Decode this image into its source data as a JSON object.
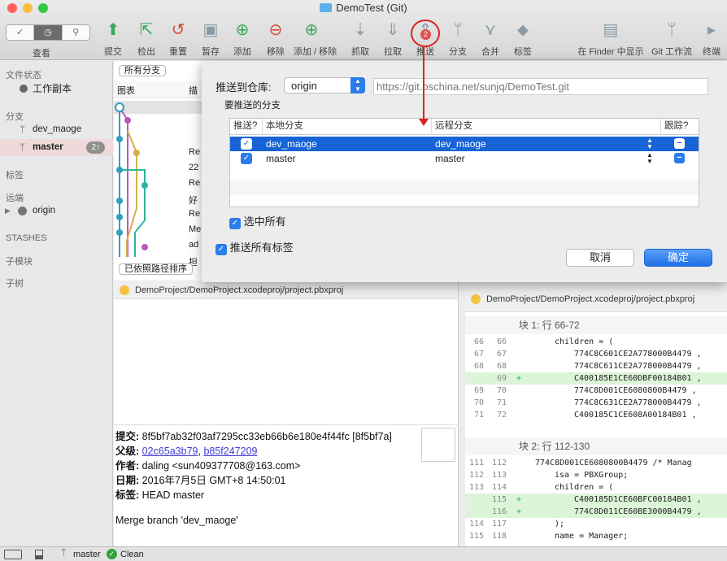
{
  "window": {
    "title": "DemoTest (Git)"
  },
  "toolbar": {
    "view_label": "查看",
    "items": [
      {
        "label": "提交",
        "icon": "commit-icon"
      },
      {
        "label": "检出",
        "icon": "checkout-icon"
      },
      {
        "label": "重置",
        "icon": "reset-icon"
      },
      {
        "label": "暂存",
        "icon": "stash-icon"
      },
      {
        "label": "添加",
        "icon": "add-icon"
      },
      {
        "label": "移除",
        "icon": "remove-icon"
      },
      {
        "label": "添加 / 移除",
        "icon": "add-remove-icon"
      },
      {
        "label": "抓取",
        "icon": "fetch-icon"
      },
      {
        "label": "拉取",
        "icon": "pull-icon"
      },
      {
        "label": "推送",
        "icon": "push-icon",
        "badge": "2"
      },
      {
        "label": "分支",
        "icon": "branch-icon"
      },
      {
        "label": "合并",
        "icon": "merge-icon"
      },
      {
        "label": "标签",
        "icon": "tag-icon"
      }
    ],
    "right_items": [
      {
        "label": "在 Finder 中显示",
        "icon": "finder-icon"
      },
      {
        "label": "Git 工作流",
        "icon": "git-flow-icon"
      },
      {
        "label": "终端",
        "icon": "terminal-icon"
      }
    ]
  },
  "sidebar": {
    "file_status": "文件状态",
    "working_copy": "工作副本",
    "branches": "分支",
    "branch_items": [
      {
        "name": "dev_maoge"
      },
      {
        "name": "master",
        "badge": "2↑"
      }
    ],
    "tags": "标签",
    "remotes": "远端",
    "remote_items": [
      {
        "name": "origin"
      }
    ],
    "stashes": "STASHES",
    "submodules": "子模块",
    "subtrees": "子树"
  },
  "graph": {
    "filter": "所有分支",
    "col_graph": "图表",
    "col_desc": "描",
    "sort": "已依照路径排序",
    "row_snippets": [
      "Re",
      "22",
      "Re",
      "好",
      "Re",
      "Me",
      "ad",
      "担"
    ]
  },
  "sheet": {
    "push_to_label": "推送到仓库:",
    "remote": "origin",
    "remote_url": "https://git.oschina.net/sunjq/DemoTest.git",
    "branches_label": "要推送的分支",
    "col_push": "推送?",
    "col_local": "本地分支",
    "col_remote": "远程分支",
    "col_track": "跟踪?",
    "rows": [
      {
        "local": "dev_maoge",
        "remote": "dev_maoge",
        "push": true,
        "track": "−"
      },
      {
        "local": "master",
        "remote": "master",
        "push": true,
        "track": "−"
      }
    ],
    "select_all": "选中所有",
    "push_all_tags": "推送所有标签",
    "cancel": "取消",
    "ok": "确定"
  },
  "left_panel": {
    "file_path": "DemoProject/DemoProject.xcodeproj/project.pbxproj",
    "commit_label": "提交:",
    "commit_value": "8f5bf7ab32f03af7295cc33eb66b6e180e4f44fc [8f5bf7a]",
    "parent_label": "父级:",
    "parent_1": "02c65a3b79",
    "parent_sep": ", ",
    "parent_2": "b85f247209",
    "author_label": "作者:",
    "author_value": "daling <sun409377708@163.com>",
    "date_label": "日期:",
    "date_value": "2016年7月5日 GMT+8 14:50:01",
    "tag_label": "标签:",
    "tag_value": "HEAD master",
    "message": "Merge branch 'dev_maoge'"
  },
  "right_panel": {
    "file_path": "DemoProject/DemoProject.xcodeproj/project.pbxproj",
    "hunk1": "块 1: 行 66-72",
    "hunk1_lines": [
      {
        "o": "66",
        "n": "66",
        "text": "children = (",
        "add": false,
        "indent": 2
      },
      {
        "o": "67",
        "n": "67",
        "text": "774C8C601CE2A778000B4479 ,",
        "add": false,
        "indent": 3
      },
      {
        "o": "68",
        "n": "68",
        "text": "774C8C611CE2A778000B4479 ,",
        "add": false,
        "indent": 3
      },
      {
        "o": "",
        "n": "69",
        "text": "C400185E1CE60DBF00184B01 ,",
        "add": true,
        "indent": 3
      },
      {
        "o": "69",
        "n": "70",
        "text": "774C8D001CE6080800B4479 ,",
        "add": false,
        "indent": 3
      },
      {
        "o": "70",
        "n": "71",
        "text": "774C8C631CE2A778000B4479 ,",
        "add": false,
        "indent": 3
      },
      {
        "o": "71",
        "n": "72",
        "text": "C400185C1CE608A00184B01 ,",
        "add": false,
        "indent": 3
      }
    ],
    "hunk2": "块 2: 行 112-130",
    "hunk2_lines": [
      {
        "o": "111",
        "n": "112",
        "text": "774C8D001CE6080800B4479 /* Manag",
        "add": false,
        "indent": 1
      },
      {
        "o": "112",
        "n": "113",
        "text": "isa = PBXGroup;",
        "add": false,
        "indent": 2
      },
      {
        "o": "113",
        "n": "114",
        "text": "children = (",
        "add": false,
        "indent": 2
      },
      {
        "o": "",
        "n": "115",
        "text": "C400185D1CE60BFC00184B01 ,",
        "add": true,
        "indent": 3
      },
      {
        "o": "",
        "n": "116",
        "text": "774C8D011CE60BE3000B4479 ,",
        "add": true,
        "indent": 3
      },
      {
        "o": "114",
        "n": "117",
        "text": ");",
        "add": false,
        "indent": 2
      },
      {
        "o": "115",
        "n": "118",
        "text": "name = Manager;",
        "add": false,
        "indent": 2
      }
    ]
  },
  "statusbar": {
    "branch": "master",
    "state": "Clean"
  },
  "colors": {
    "accent": "#2b7de9",
    "annotation": "#d22222",
    "selected_row": "#1864d6",
    "added_line": "#dcf5d8"
  }
}
